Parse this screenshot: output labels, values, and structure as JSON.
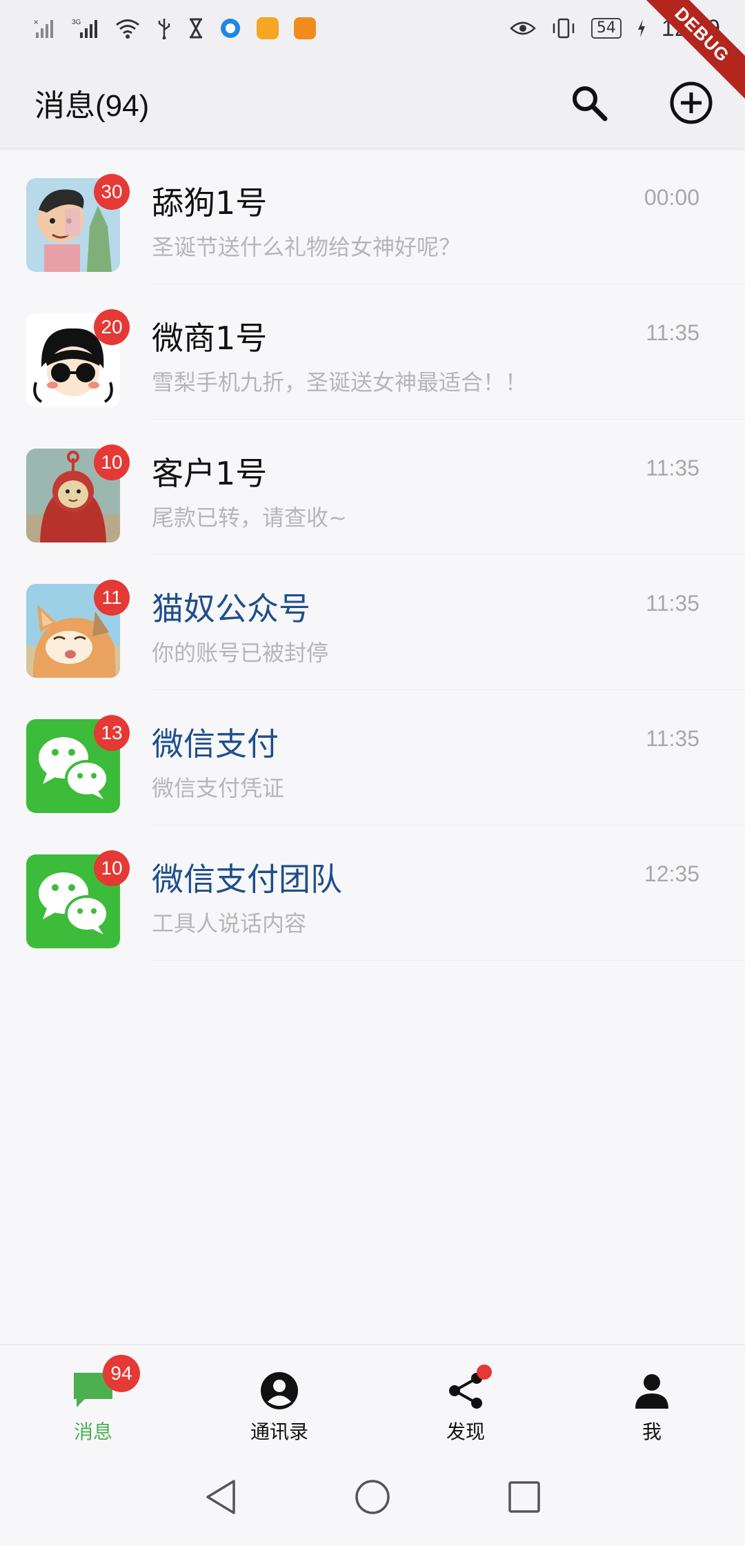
{
  "status_bar": {
    "time": "12:59",
    "battery": "54",
    "icons": [
      "signal-x-icon",
      "signal-3g-icon",
      "wifi-icon",
      "usb-icon",
      "hourglass-icon",
      "browser-icon",
      "app-icon-yellow",
      "app-icon-orange",
      "eye-icon",
      "vibrate-icon",
      "battery-icon",
      "charging-icon"
    ]
  },
  "debug_banner": "DEBUG",
  "app_bar": {
    "title": "消息(94)",
    "actions": [
      "search-icon",
      "add-circle-icon"
    ]
  },
  "chats": [
    {
      "name": "舔狗1号",
      "preview": "圣诞节送什么礼物给女神好呢？",
      "time": "00:00",
      "badge": "30",
      "official": false,
      "avatar": "cartoon-boy-avatar"
    },
    {
      "name": "微商1号",
      "preview": "雪梨手机九折，圣诞送女神最适合！！",
      "time": "11:35",
      "badge": "20",
      "official": false,
      "avatar": "cartoon-girl-sunglasses-avatar"
    },
    {
      "name": "客户1号",
      "preview": "尾款已转，请查收~",
      "time": "11:35",
      "badge": "10",
      "official": false,
      "avatar": "teletubby-avatar"
    },
    {
      "name": "猫奴公众号",
      "preview": "你的账号已被封停",
      "time": "11:35",
      "badge": "11",
      "official": true,
      "avatar": "cat-avatar"
    },
    {
      "name": "微信支付",
      "preview": "微信支付凭证",
      "time": "11:35",
      "badge": "13",
      "official": true,
      "avatar": "wechat-logo-avatar"
    },
    {
      "name": "微信支付团队",
      "preview": "工具人说话内容",
      "time": "12:35",
      "badge": "10",
      "official": true,
      "avatar": "wechat-logo-avatar"
    }
  ],
  "bottom_nav": [
    {
      "label": "消息",
      "icon": "chat-bubble-icon",
      "badge": "94",
      "active": true
    },
    {
      "label": "通讯录",
      "icon": "contacts-icon",
      "badge": null,
      "active": false
    },
    {
      "label": "发现",
      "icon": "share-icon",
      "dot": true,
      "active": false
    },
    {
      "label": "我",
      "icon": "person-icon",
      "badge": null,
      "active": false
    }
  ],
  "system_nav": [
    "back-icon",
    "home-icon",
    "recents-icon"
  ],
  "colors": {
    "accent_green": "#4caf50",
    "badge_red": "#e53935",
    "official_blue": "#1f4e8c",
    "wechat_green": "#3dbb3a"
  }
}
